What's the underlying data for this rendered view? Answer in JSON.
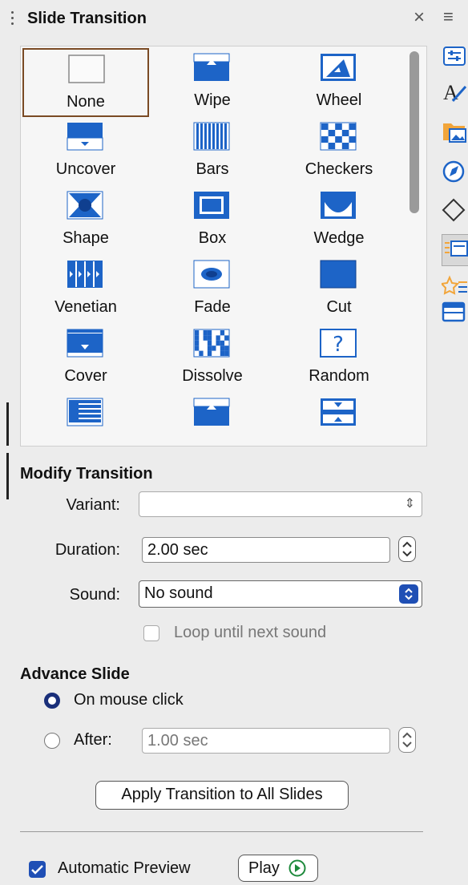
{
  "panel": {
    "title": "Slide Transition",
    "close_glyph": "×",
    "menu_glyph": "≡"
  },
  "deck_icons": [
    "properties-icon",
    "styles-icon",
    "gallery-icon",
    "navigator-icon",
    "shapes-icon",
    "slide-transition-icon",
    "animation-icon",
    "master-slides-icon"
  ],
  "transitions": [
    {
      "label": "None",
      "icon": "none"
    },
    {
      "label": "Wipe",
      "icon": "wipe"
    },
    {
      "label": "Wheel",
      "icon": "wheel"
    },
    {
      "label": "Uncover",
      "icon": "uncover"
    },
    {
      "label": "Bars",
      "icon": "bars"
    },
    {
      "label": "Checkers",
      "icon": "checkers"
    },
    {
      "label": "Shape",
      "icon": "shape"
    },
    {
      "label": "Box",
      "icon": "box"
    },
    {
      "label": "Wedge",
      "icon": "wedge"
    },
    {
      "label": "Venetian",
      "icon": "venetian"
    },
    {
      "label": "Fade",
      "icon": "fade"
    },
    {
      "label": "Cut",
      "icon": "cut"
    },
    {
      "label": "Cover",
      "icon": "cover"
    },
    {
      "label": "Dissolve",
      "icon": "dissolve"
    },
    {
      "label": "Random",
      "icon": "random"
    },
    {
      "label": "",
      "icon": "split-partial"
    },
    {
      "label": "",
      "icon": "push-partial"
    },
    {
      "label": "",
      "icon": "roll-partial"
    }
  ],
  "selected_transition": "None",
  "modify": {
    "title": "Modify Transition",
    "variant_label": "Variant:",
    "variant_value": "",
    "duration_label": "Duration:",
    "duration_value": "2.00 sec",
    "sound_label": "Sound:",
    "sound_value": "No sound",
    "loop_label": "Loop until next sound",
    "loop_checked": false
  },
  "advance": {
    "title": "Advance Slide",
    "on_click_label": "On mouse click",
    "on_click_selected": true,
    "after_label": "After:",
    "after_value": "1.00 sec",
    "apply_all_label": "Apply Transition to All Slides"
  },
  "footer": {
    "auto_preview_label": "Automatic Preview",
    "auto_preview_checked": true,
    "play_label": "Play"
  },
  "colors": {
    "accent": "#1d64c7",
    "selected_border": "#7a4a24",
    "radio": "#1a2f7a"
  }
}
